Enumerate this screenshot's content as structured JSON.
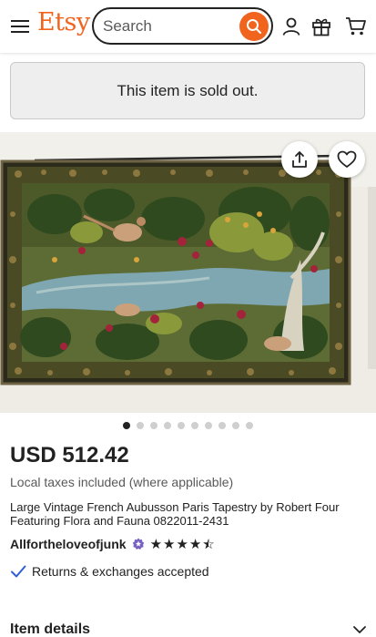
{
  "header": {
    "logo": "Etsy",
    "search_placeholder": "Search",
    "brand_color": "#F1641E",
    "icons": [
      "menu-icon",
      "search-icon",
      "account-icon",
      "gift-icon",
      "cart-icon"
    ]
  },
  "notice": {
    "text": "This item is sold out."
  },
  "gallery": {
    "image_count": 10,
    "active_index": 0,
    "icons": [
      "share-icon",
      "heart-icon"
    ]
  },
  "listing": {
    "price": "USD 512.42",
    "tax_note": "Local taxes included (where applicable)",
    "title": "Large Vintage French Aubusson Paris Tapestry by Robert Four Featuring Flora and Fauna 0822011-2431",
    "shop_name": "Allfortheloveofjunk",
    "rating": 4.5,
    "returns_text": "Returns & exchanges accepted"
  },
  "sections": {
    "item_details_label": "Item details"
  }
}
